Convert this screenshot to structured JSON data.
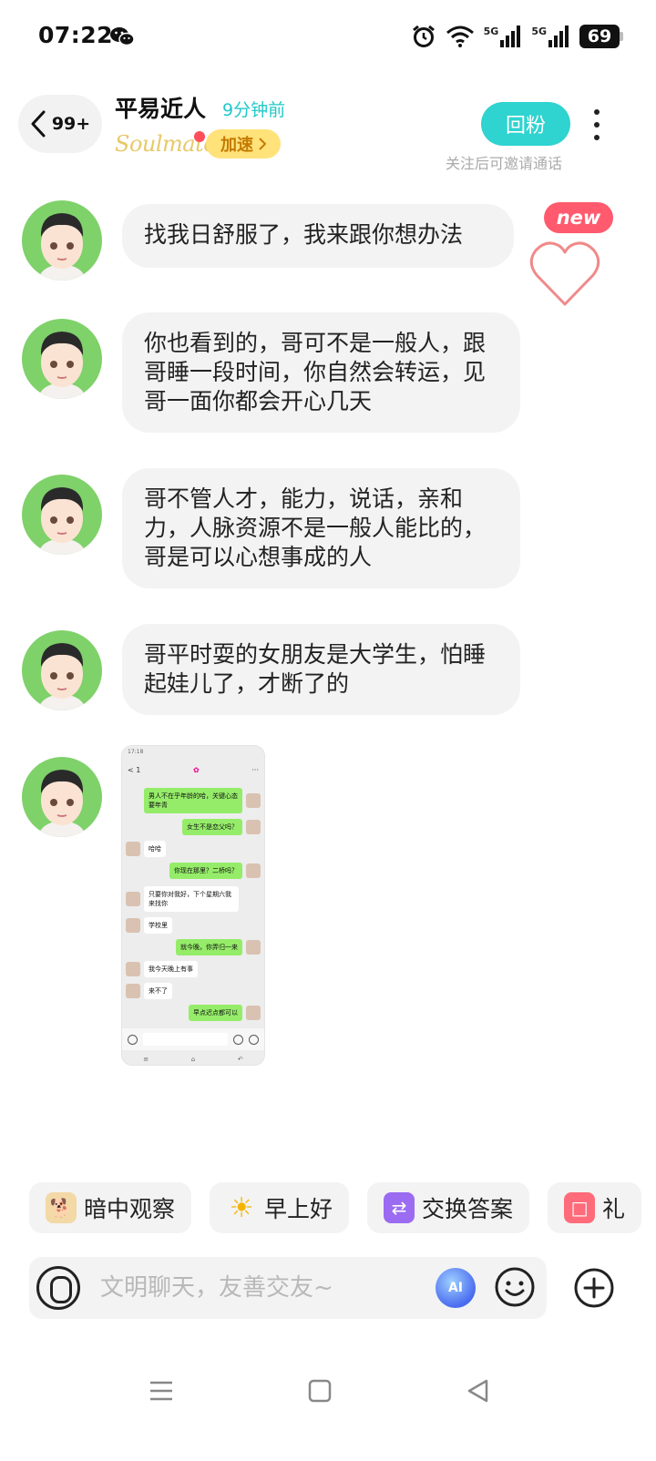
{
  "status_bar": {
    "time": "07:22",
    "network_1": "5G",
    "network_2": "5G",
    "battery": "69"
  },
  "header": {
    "unread_count": "99+",
    "contact_name": "平易近人",
    "last_seen": "9分钟前",
    "soulmate_logo": "Soulmate",
    "speed_label": "加速",
    "follow_back_label": "回粉",
    "follow_hint": "关注后可邀请通话"
  },
  "messages": [
    {
      "text": "找我日舒服了，我来跟你想办法"
    },
    {
      "text": "你也看到的，哥可不是一般人，跟哥睡一段时间，你自然会转运，见哥一面你都会开心几天"
    },
    {
      "text": "哥不管人才，能力，说话，亲和力，人脉资源不是一般人能比的，哥是可以心想事成的人"
    },
    {
      "text": "哥平时耍的女朋友是大学生，怕睡起娃儿了，才断了的"
    }
  ],
  "new_badge": "new",
  "screenshot": {
    "time": "17:18",
    "back_label": "< 1",
    "lines": [
      {
        "side": "right",
        "text": "男人不在乎年龄的哈，关键心态要年青"
      },
      {
        "side": "right",
        "text": "女生不是恋父吗？"
      },
      {
        "side": "left",
        "text": "哈哈"
      },
      {
        "side": "right",
        "text": "你现在那里？二桥吗？"
      },
      {
        "side": "left",
        "text": "只要你对我好，下个星期六我来找你"
      },
      {
        "side": "left",
        "text": "学校里"
      },
      {
        "side": "right",
        "text": "就今晚，你弄归一来"
      },
      {
        "side": "left",
        "text": "我今天晚上有事"
      },
      {
        "side": "left",
        "text": "来不了"
      },
      {
        "side": "right",
        "text": "早点迟点都可以"
      }
    ]
  },
  "quick_replies": [
    {
      "icon": "dog-peek-icon",
      "label": "暗中观察"
    },
    {
      "icon": "sun-icon",
      "label": "早上好"
    },
    {
      "icon": "swap-icon",
      "label": "交换答案"
    },
    {
      "icon": "gift-icon",
      "label": "礼"
    }
  ],
  "input": {
    "placeholder": "文明聊天，友善交友~"
  },
  "colors": {
    "accent": "#2fd3cf",
    "last_seen": "#20c9c9",
    "new_badge": "#ff5a6e",
    "speed_badge": "#ffe27a",
    "avatar_bg": "#7fd16a",
    "bubble_bg": "#f3f3f3"
  }
}
